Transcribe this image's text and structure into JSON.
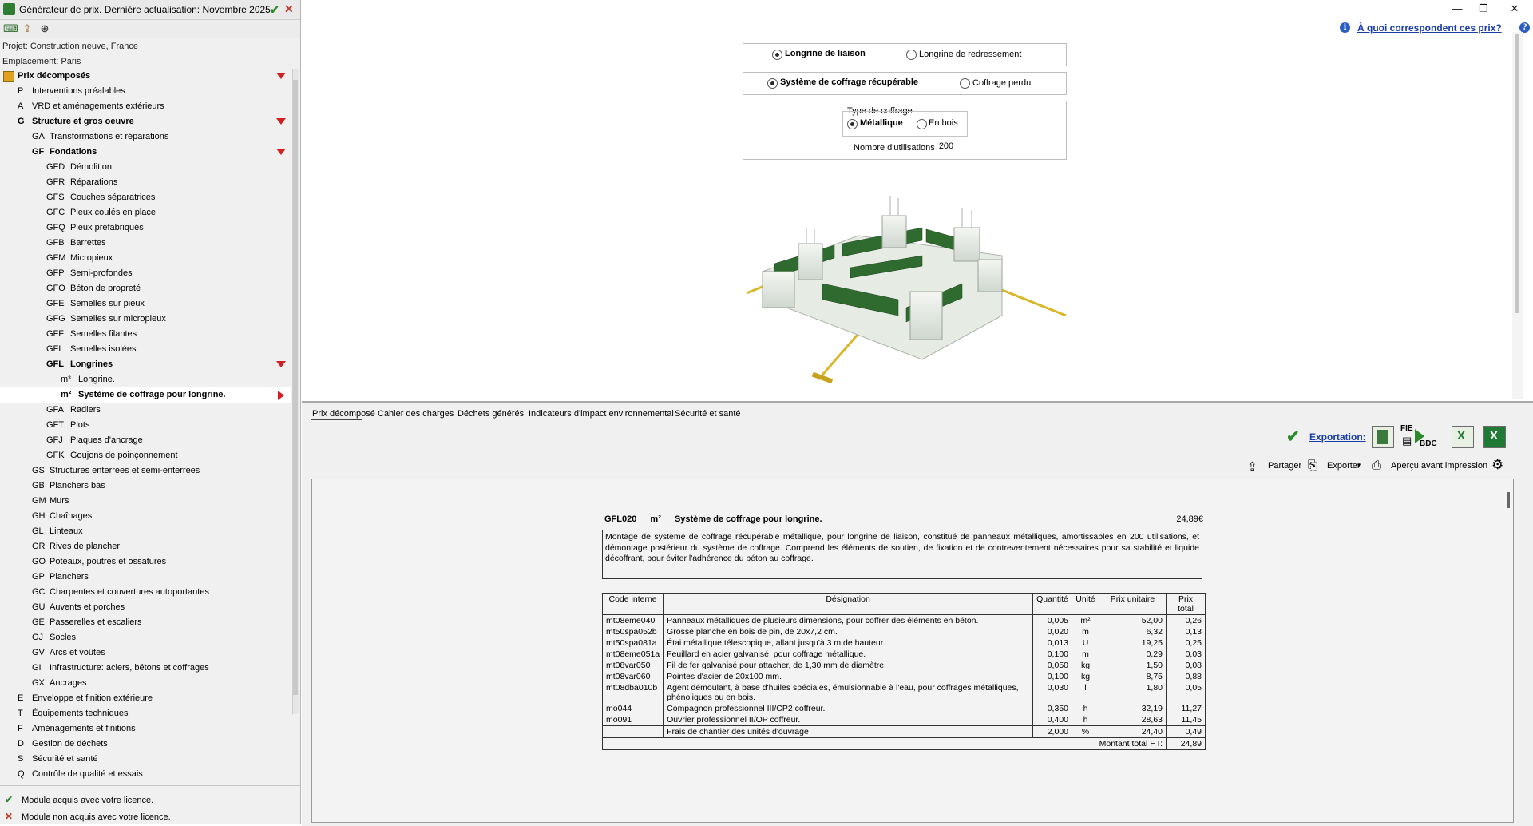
{
  "app": {
    "title": "Générateur de prix. Dernière actualisation: Novembre 2025",
    "project": "Projet: Construction neuve, France",
    "location": "Emplacement: Paris"
  },
  "tree": [
    {
      "code": "",
      "label": "Prix décomposés",
      "bold": true,
      "indent": 0,
      "marker": "down",
      "folder": true
    },
    {
      "code": "P",
      "label": "Interventions préalables",
      "indent": 1
    },
    {
      "code": "A",
      "label": "VRD et aménagements extérieurs",
      "indent": 1
    },
    {
      "code": "G",
      "label": "Structure et gros oeuvre",
      "bold": true,
      "indent": 1,
      "marker": "down"
    },
    {
      "code": "GA",
      "label": "Transformations et réparations",
      "indent": 2
    },
    {
      "code": "GF",
      "label": "Fondations",
      "bold": true,
      "indent": 2,
      "marker": "down"
    },
    {
      "code": "GFD",
      "label": "Démolition",
      "indent": 3
    },
    {
      "code": "GFR",
      "label": "Réparations",
      "indent": 3
    },
    {
      "code": "GFS",
      "label": "Couches séparatrices",
      "indent": 3
    },
    {
      "code": "GFC",
      "label": "Pieux coulés en place",
      "indent": 3
    },
    {
      "code": "GFQ",
      "label": "Pieux préfabriqués",
      "indent": 3
    },
    {
      "code": "GFB",
      "label": "Barrettes",
      "indent": 3
    },
    {
      "code": "GFM",
      "label": "Micropieux",
      "indent": 3
    },
    {
      "code": "GFP",
      "label": "Semi-profondes",
      "indent": 3
    },
    {
      "code": "GFO",
      "label": "Béton de propreté",
      "indent": 3
    },
    {
      "code": "GFE",
      "label": "Semelles sur pieux",
      "indent": 3
    },
    {
      "code": "GFG",
      "label": "Semelles sur micropieux",
      "indent": 3
    },
    {
      "code": "GFF",
      "label": "Semelles filantes",
      "indent": 3
    },
    {
      "code": "GFI",
      "label": "Semelles isolées",
      "indent": 3
    },
    {
      "code": "GFL",
      "label": "Longrines",
      "bold": true,
      "indent": 3,
      "marker": "down"
    },
    {
      "code": "m³",
      "label": "Longrine.",
      "indent": 4
    },
    {
      "code": "m²",
      "label": "Système de coffrage pour longrine.",
      "bold": true,
      "indent": 4,
      "marker": "right",
      "selected": true
    },
    {
      "code": "GFA",
      "label": "Radiers",
      "indent": 3
    },
    {
      "code": "GFT",
      "label": "Plots",
      "indent": 3
    },
    {
      "code": "GFJ",
      "label": "Plaques d'ancrage",
      "indent": 3
    },
    {
      "code": "GFK",
      "label": "Goujons de poinçonnement",
      "indent": 3
    },
    {
      "code": "GS",
      "label": "Structures enterrées et semi-enterrées",
      "indent": 2
    },
    {
      "code": "GB",
      "label": "Planchers bas",
      "indent": 2
    },
    {
      "code": "GM",
      "label": "Murs",
      "indent": 2
    },
    {
      "code": "GH",
      "label": "Chaînages",
      "indent": 2
    },
    {
      "code": "GL",
      "label": "Linteaux",
      "indent": 2
    },
    {
      "code": "GR",
      "label": "Rives de plancher",
      "indent": 2
    },
    {
      "code": "GO",
      "label": "Poteaux, poutres et ossatures",
      "indent": 2
    },
    {
      "code": "GP",
      "label": "Planchers",
      "indent": 2
    },
    {
      "code": "GC",
      "label": "Charpentes et couvertures autoportantes",
      "indent": 2
    },
    {
      "code": "GU",
      "label": "Auvents et porches",
      "indent": 2
    },
    {
      "code": "GE",
      "label": "Passerelles et escaliers",
      "indent": 2
    },
    {
      "code": "GJ",
      "label": "Socles",
      "indent": 2
    },
    {
      "code": "GV",
      "label": "Arcs et voûtes",
      "indent": 2
    },
    {
      "code": "GI",
      "label": "Infrastructure: aciers, bétons et coffrages",
      "indent": 2
    },
    {
      "code": "GX",
      "label": "Ancrages",
      "indent": 2
    },
    {
      "code": "E",
      "label": "Enveloppe et finition extérieure",
      "indent": 1
    },
    {
      "code": "T",
      "label": "Équipements techniques",
      "indent": 1
    },
    {
      "code": "F",
      "label": "Aménagements et finitions",
      "indent": 1
    },
    {
      "code": "D",
      "label": "Gestion de déchets",
      "indent": 1
    },
    {
      "code": "S",
      "label": "Sécurité et santé",
      "indent": 1
    },
    {
      "code": "Q",
      "label": "Contrôle de qualité et essais",
      "indent": 1
    }
  ],
  "legend": {
    "acquired": "Module acquis avec votre licence.",
    "not_acquired": "Module non acquis avec votre licence."
  },
  "help_link": "À quoi correspondent ces prix?",
  "options": {
    "longrine": {
      "opt1": "Longrine de liaison",
      "opt2": "Longrine de redressement",
      "selected": 1
    },
    "coffrage": {
      "opt1": "Système de coffrage récupérable",
      "opt2": "Coffrage perdu",
      "selected": 1
    },
    "type_title": "Type de coffrage",
    "type": {
      "opt1": "Métallique",
      "opt2": "En bois",
      "selected": 1
    },
    "uses_label": "Nombre d'utilisations",
    "uses_value": "200"
  },
  "tabs": [
    "Prix décomposé",
    "Cahier des charges",
    "Déchets générés",
    "Indicateurs d'impact environnemental",
    "Sécurité et santé"
  ],
  "toolbar": {
    "exportation": "Exportation:",
    "fie": "FIE",
    "bdc": "BDC",
    "share": "Partager",
    "export": "Exporter",
    "preview": "Aperçu avant impression"
  },
  "report": {
    "code": "GFL020",
    "unit": "m²",
    "title": "Système de coffrage pour longrine.",
    "price": "24,89€",
    "description": "Montage de système de coffrage récupérable métallique, pour longrine de liaison, constitué de panneaux métalliques, amortissables en 200 utilisations, et démontage postérieur du système de coffrage. Comprend les éléments de soutien, de fixation et de contreventement nécessaires pour sa stabilité et liquide décoffrant, pour éviter l'adhérence du béton au coffrage.",
    "headers": [
      "Code interne",
      "Désignation",
      "Quantité",
      "Unité",
      "Prix unitaire",
      "Prix total"
    ],
    "rows": [
      [
        "mt08eme040",
        "Panneaux métalliques de plusieurs dimensions, pour coffrer des éléments en béton.",
        "0,005",
        "m²",
        "52,00",
        "0,26"
      ],
      [
        "mt50spa052b",
        "Grosse planche en bois de pin, de 20x7,2 cm.",
        "0,020",
        "m",
        "6,32",
        "0,13"
      ],
      [
        "mt50spa081a",
        "Étai métallique télescopique, allant jusqu'à 3 m de hauteur.",
        "0,013",
        "U",
        "19,25",
        "0,25"
      ],
      [
        "mt08eme051a",
        "Feuillard en acier galvanisé, pour coffrage métallique.",
        "0,100",
        "m",
        "0,29",
        "0,03"
      ],
      [
        "mt08var050",
        "Fil de fer galvanisé pour attacher, de 1,30 mm de diamètre.",
        "0,050",
        "kg",
        "1,50",
        "0,08"
      ],
      [
        "mt08var060",
        "Pointes d'acier de 20x100 mm.",
        "0,100",
        "kg",
        "8,75",
        "0,88"
      ],
      [
        "mt08dba010b",
        "Agent démoulant, à base d'huiles spéciales, émulsionnable à l'eau, pour coffrages métalliques, phénoliques ou en bois.",
        "0,030",
        "l",
        "1,80",
        "0,05"
      ],
      [
        "mo044",
        "Compagnon professionnel III/CP2 coffreur.",
        "0,350",
        "h",
        "32,19",
        "11,27"
      ],
      [
        "mo091",
        "Ouvrier professionnel II/OP coffreur.",
        "0,400",
        "h",
        "28,63",
        "11,45"
      ]
    ],
    "site_costs": [
      "",
      "Frais de chantier des unités d'ouvrage",
      "2,000",
      "%",
      "24,40",
      "0,49"
    ],
    "total_label": "Montant total HT:",
    "total_value": "24,89"
  }
}
